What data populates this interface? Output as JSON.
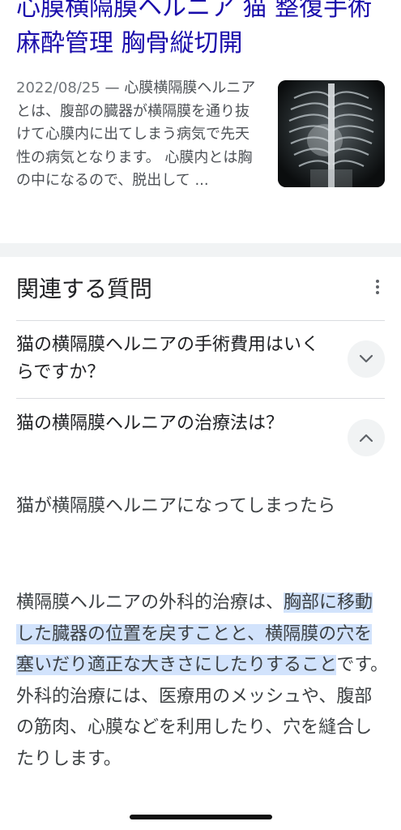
{
  "result": {
    "title": "心膜横隔膜ヘルニア 猫 整復手術 麻酔管理 胸骨縦切開",
    "date": "2022/08/25",
    "snippet": " — 心膜横隔膜ヘルニアとは、腹部の臓器が横隔膜を通り抜けて心膜内に出てしまう病気で先天性の病気となります。 心膜内とは胸の中になるので、脱出して ..."
  },
  "paa": {
    "title": "関連する質問",
    "questions": [
      {
        "text": "猫の横隔膜ヘルニアの手術費用はいくらですか？",
        "state": "collapsed"
      },
      {
        "text": "猫の横隔膜ヘルニアの治療法は？",
        "state": "expanded"
      }
    ],
    "answer": {
      "heading": "猫が横隔膜ヘルニアになってしまったら",
      "body_pre": "横隔膜ヘルニアの外科的治療は、",
      "body_highlight": "胸部に移動した臓器の位置を戻すことと、横隔膜の穴を塞いだり適正な大きさにしたりすること",
      "body_post": "です。 外科的治療には、医療用のメッシュや、腹部の筋肉、心膜などを利用したり、穴を縫合したりします。"
    }
  },
  "icons": {
    "thumbnail": "xray-image",
    "more": "more-vert-icon",
    "expand": "chevron-down-icon",
    "collapse": "chevron-up-icon"
  },
  "colors": {
    "title_link": "#1a0dab",
    "highlight": "#d2e3fc",
    "separator": "#f1f3f4"
  }
}
